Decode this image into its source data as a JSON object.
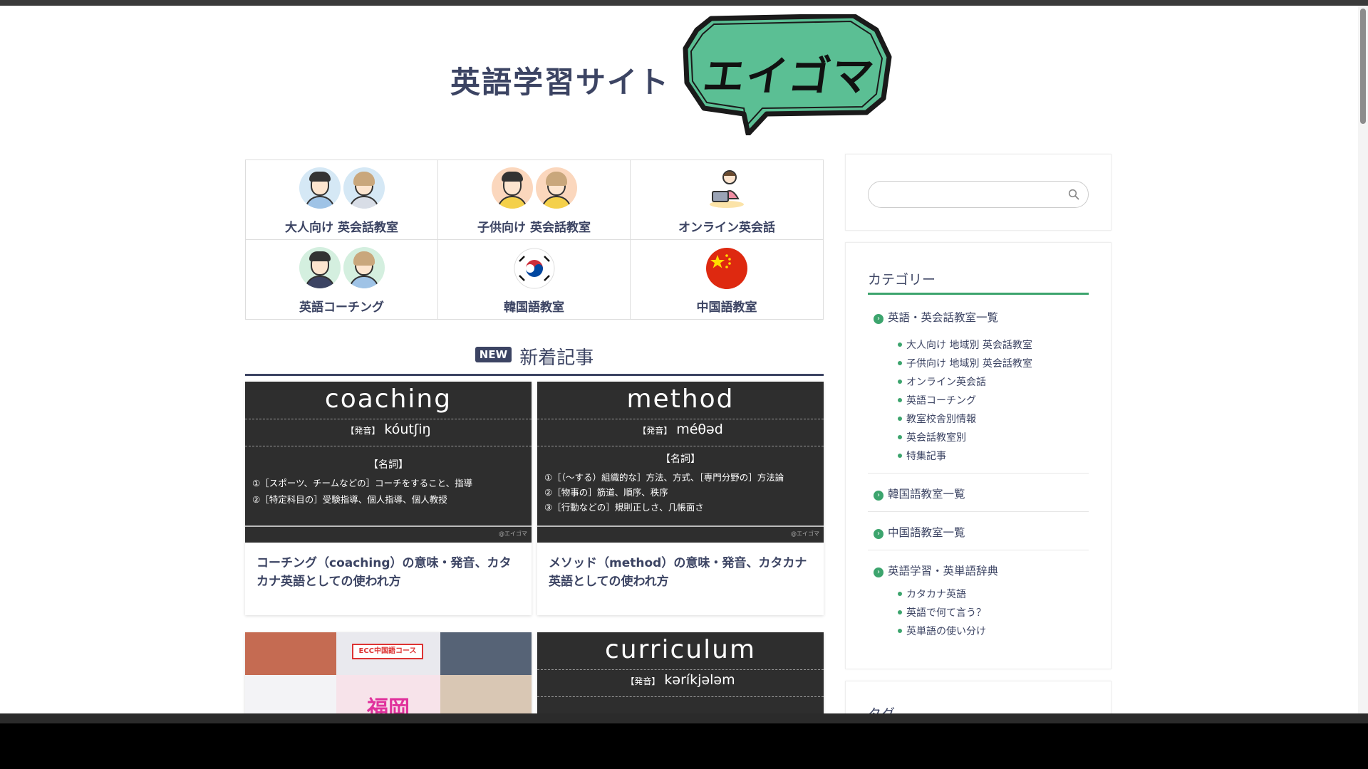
{
  "header": {
    "site_title": "英語学習サイト",
    "logo_text": "エイゴマ"
  },
  "categories": [
    {
      "label": "大人向け 英会話教室"
    },
    {
      "label": "子供向け 英会話教室"
    },
    {
      "label": "オンライン英会話"
    },
    {
      "label": "英語コーチング"
    },
    {
      "label": "韓国語教室"
    },
    {
      "label": "中国語教室"
    }
  ],
  "new_section": {
    "badge": "NEW",
    "title": "新着記事"
  },
  "articles": [
    {
      "word": "coaching",
      "pron_label": "【発音】",
      "pron": "kóutʃiŋ",
      "pos": "【名詞】",
      "defs": [
        "①［スポーツ、チームなどの］コーチをすること、指導",
        "②［特定科目の］受験指導、個人指導、個人教授"
      ],
      "credit": "@エイゴマ",
      "title": "コーチング（coaching）の意味・発音、カタカナ英語としての使われ方"
    },
    {
      "word": "method",
      "pron_label": "【発音】",
      "pron": "méθəd",
      "pos": "【名詞】",
      "defs": [
        "①［（～する）組織的な］方法、方式、［専門分野の］方法論",
        "②［物事の］筋道、順序、秩序",
        "③［行動などの］規則正しさ、几帳面さ"
      ],
      "credit": "@エイゴマ",
      "title": "メソッド（method）の意味・発音、カタカナ英語としての使われ方"
    },
    {
      "collage_label": "福岡",
      "collage_badge": "ECC中国語コース"
    },
    {
      "word": "curriculum",
      "pron_label": "【発音】",
      "pron": "kəríkjələm"
    }
  ],
  "sidebar": {
    "search_placeholder": "",
    "category_heading": "カテゴリー",
    "groups": [
      {
        "label": "英語・英会話教室一覧",
        "children": [
          "大人向け 地域別 英会話教室",
          "子供向け 地域別 英会話教室",
          "オンライン英会話",
          "英語コーチング",
          "教室校舎別情報",
          "英会話教室別",
          "特集記事"
        ]
      },
      {
        "label": "韓国語教室一覧",
        "children": []
      },
      {
        "label": "中国語教室一覧",
        "children": []
      },
      {
        "label": "英語学習・英単語辞典",
        "children": [
          "カタカナ英語",
          "英語で何て言う？",
          "英単語の使い分け"
        ]
      }
    ],
    "tag_heading": "タグ"
  },
  "colors": {
    "navy": "#3c4463",
    "green": "#3ca46d",
    "logo_green": "#5bbf94",
    "thumb_bg": "#2e2e2e"
  }
}
